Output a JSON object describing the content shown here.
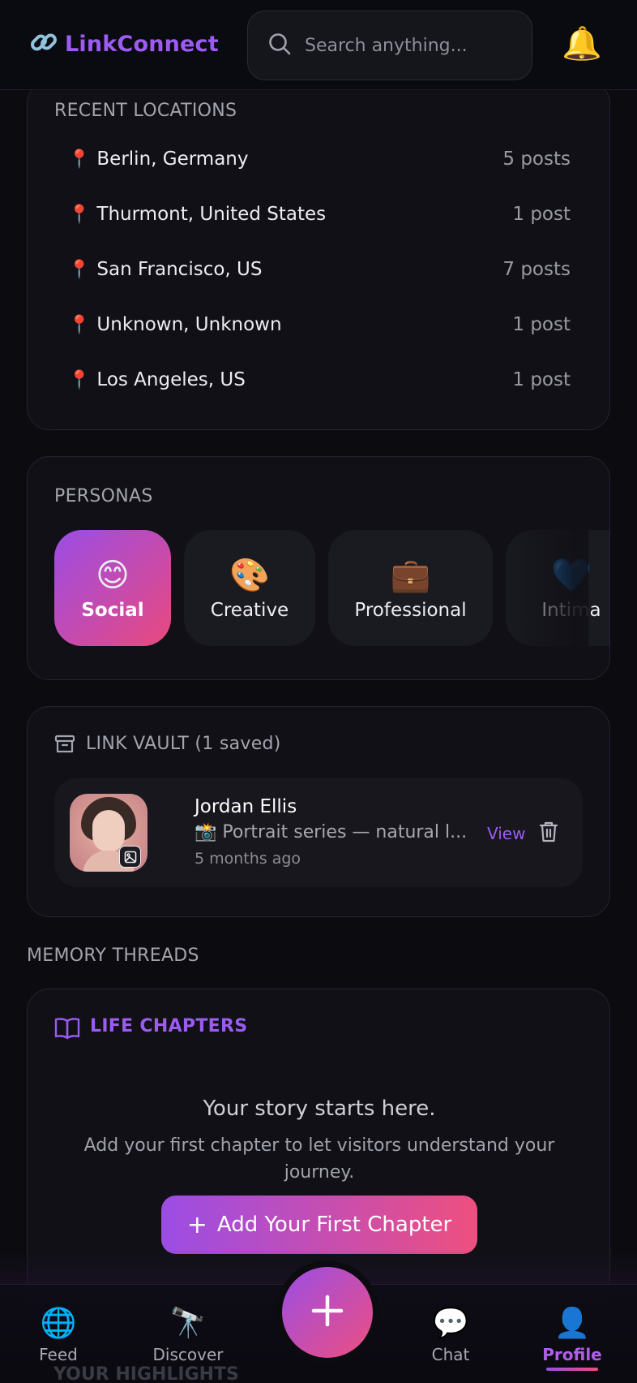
{
  "header": {
    "app_name": "LinkConnect",
    "search_placeholder": "Search anything...",
    "bell_icon": "🔔",
    "brand_color": "#9c5cf2"
  },
  "recent_locations": {
    "title": "RECENT LOCATIONS",
    "pin_icon": "📍",
    "items": [
      {
        "name": "Berlin, Germany",
        "count": "5 posts"
      },
      {
        "name": "Thurmont, United States",
        "count": "1 post"
      },
      {
        "name": "San Francisco, US",
        "count": "7 posts"
      },
      {
        "name": "Unknown, Unknown",
        "count": "1 post"
      },
      {
        "name": "Los Angeles, US",
        "count": "1 post"
      }
    ]
  },
  "personas": {
    "title": "PERSONAS",
    "items": [
      {
        "emoji": "😊",
        "label": "Social",
        "active": true
      },
      {
        "emoji": "🎨",
        "label": "Creative",
        "active": false
      },
      {
        "emoji": "💼",
        "label": "Professional",
        "active": false
      },
      {
        "emoji": "💙",
        "label": "Intima",
        "active": false
      }
    ]
  },
  "link_vault": {
    "title": "LINK VAULT (1 saved)",
    "item": {
      "name": "Jordan Ellis",
      "description": "📸 Portrait series — natural l...",
      "time": "5 months ago",
      "view_label": "View"
    }
  },
  "memory": {
    "title": "MEMORY THREADS",
    "chapters_title": "LIFE CHAPTERS",
    "empty_heading": "Your story starts here.",
    "empty_text": "Add your first chapter to let visitors understand your journey.",
    "add_button": "Add Your First Chapter",
    "add_plus": "+",
    "next_section_peek": "YOUR HIGHLIGHTS"
  },
  "nav": {
    "items": [
      {
        "icon": "🌐",
        "label": "Feed"
      },
      {
        "icon": "🔭",
        "label": "Discover"
      },
      {
        "icon": "💬",
        "label": "Chat"
      },
      {
        "icon": "👤",
        "label": "Profile"
      }
    ],
    "active": "Profile"
  },
  "accent_gradient": [
    "#9b4de6",
    "#ee4f7f"
  ]
}
